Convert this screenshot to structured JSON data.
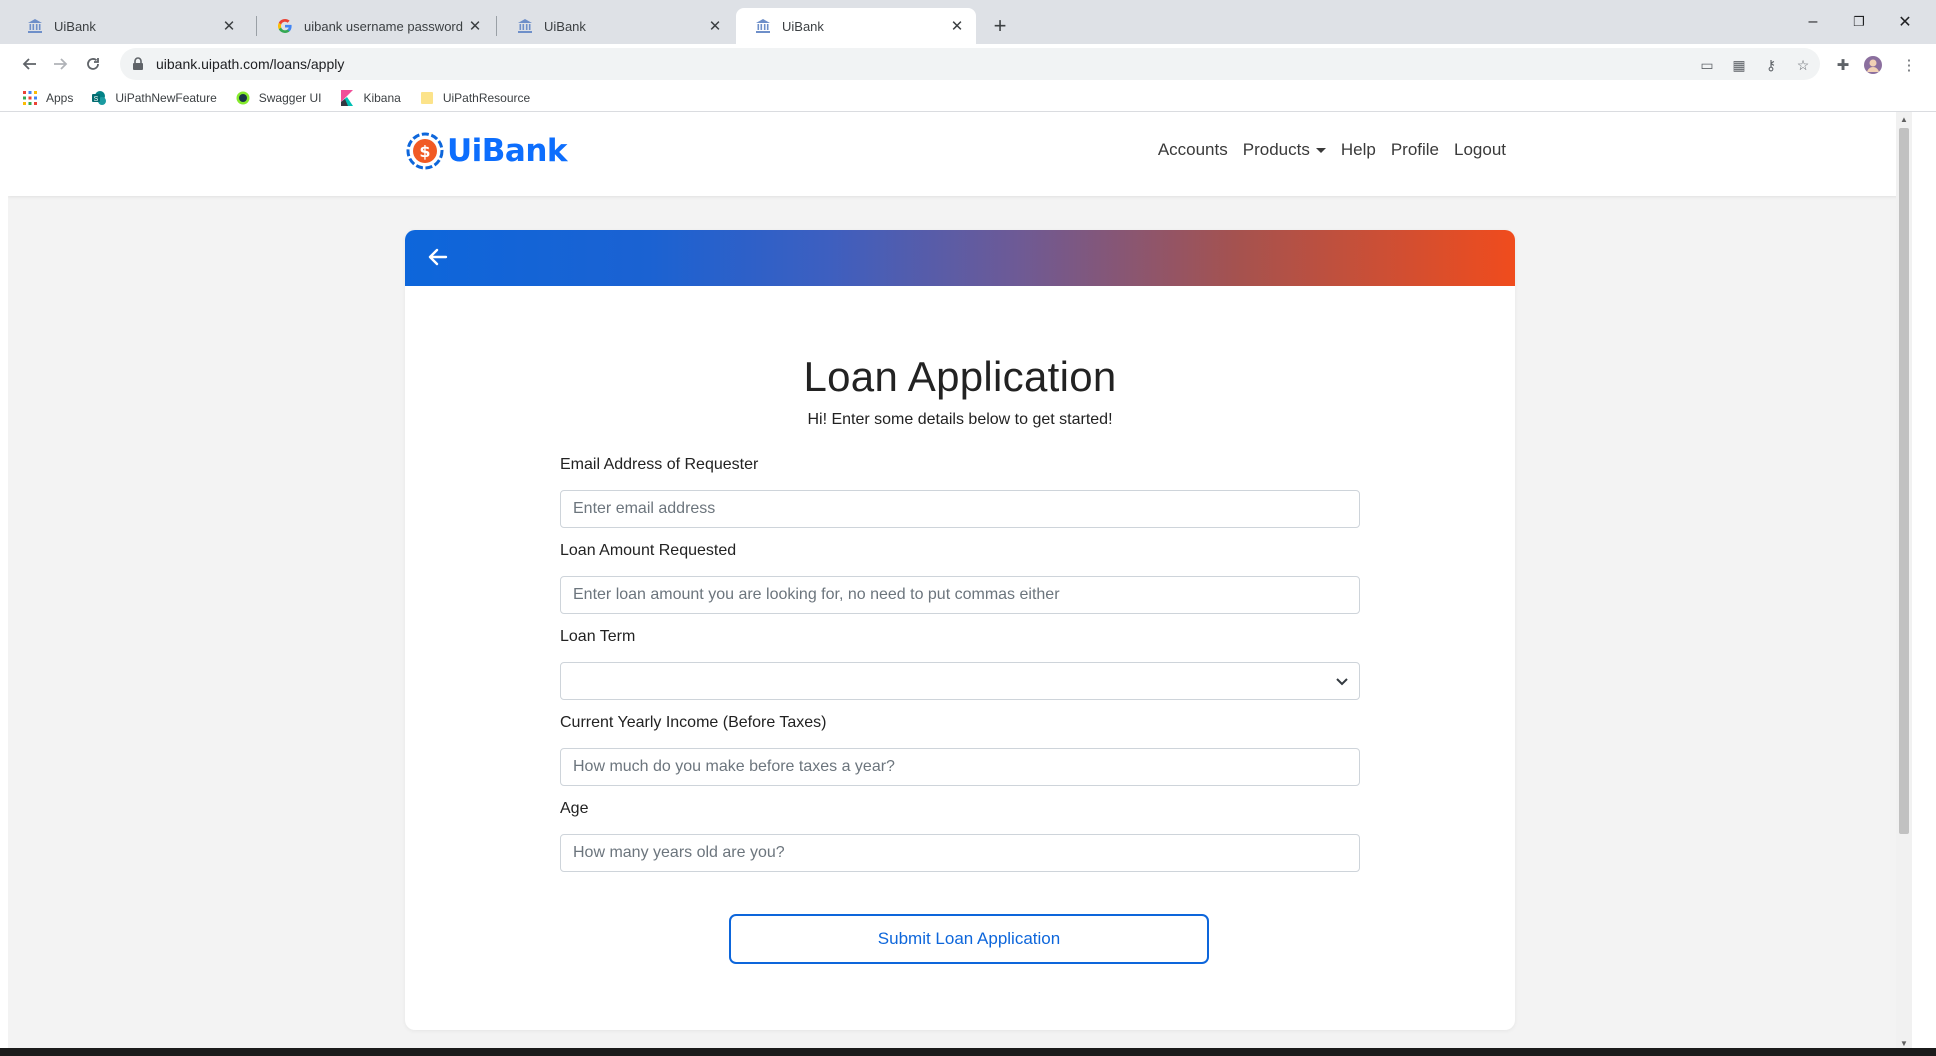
{
  "browser": {
    "tabs": [
      {
        "title": "UiBank",
        "icon": "bank-icon",
        "active": false
      },
      {
        "title": "uibank username password - Goo",
        "icon": "google-icon",
        "active": false
      },
      {
        "title": "UiBank",
        "icon": "bank-icon",
        "active": false
      },
      {
        "title": "UiBank",
        "icon": "bank-icon",
        "active": true
      }
    ],
    "new_tab_label": "+",
    "window_controls": {
      "minimize": "–",
      "restore": "❐",
      "close": "✕"
    },
    "url": "uibank.uipath.com/loans/apply",
    "bookmarks": [
      {
        "label": "Apps",
        "icon": "apps-grid-icon"
      },
      {
        "label": "UiPathNewFeature",
        "icon": "sharepoint-icon"
      },
      {
        "label": "Swagger UI",
        "icon": "swagger-icon"
      },
      {
        "label": "Kibana",
        "icon": "kibana-icon"
      },
      {
        "label": "UiPathResource",
        "icon": "folder-icon"
      }
    ]
  },
  "site": {
    "brand": "UiBank",
    "nav": {
      "accounts": "Accounts",
      "products": "Products",
      "help": "Help",
      "profile": "Profile",
      "logout": "Logout"
    }
  },
  "form": {
    "title": "Loan Application",
    "subtitle": "Hi! Enter some details below to get started!",
    "email": {
      "label": "Email Address of Requester",
      "placeholder": "Enter email address",
      "value": ""
    },
    "amount": {
      "label": "Loan Amount Requested",
      "placeholder": "Enter loan amount you are looking for, no need to put commas either",
      "value": ""
    },
    "term": {
      "label": "Loan Term",
      "selected": ""
    },
    "income": {
      "label": "Current Yearly Income (Before Taxes)",
      "placeholder": "How much do you make before taxes a year?",
      "value": ""
    },
    "age": {
      "label": "Age",
      "placeholder": "How many years old are you?",
      "value": ""
    },
    "submit_label": "Submit Loan Application"
  },
  "colors": {
    "brand_blue": "#0d66db",
    "gradient_end": "#f04c1d",
    "page_bg": "#f3f3f3"
  }
}
